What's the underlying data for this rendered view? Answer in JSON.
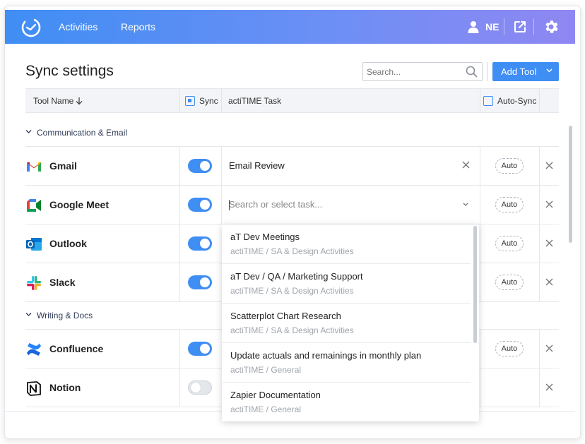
{
  "header": {
    "nav": [
      "Activities",
      "Reports"
    ],
    "user_initials": "NE",
    "icons": [
      "clock-logo-icon",
      "user-icon",
      "external-link-icon",
      "gear-icon"
    ]
  },
  "page": {
    "title": "Sync settings",
    "search_placeholder": "Search...",
    "add_tool_label": "Add Tool"
  },
  "table": {
    "headers": {
      "tool_name": "Tool Name",
      "sync": "Sync",
      "task": "actiTIME Task",
      "auto_sync": "Auto-Sync"
    },
    "groups": [
      {
        "label": "Communication & Email",
        "rows": [
          {
            "name": "Gmail",
            "sync": true,
            "task": "Email Review",
            "auto": "Auto"
          },
          {
            "name": "Google Meet",
            "sync": true,
            "task_placeholder": "Search or select task...",
            "auto": "Auto"
          },
          {
            "name": "Outlook",
            "sync": true,
            "auto": "Auto"
          },
          {
            "name": "Slack",
            "sync": true,
            "auto": "Auto"
          }
        ]
      },
      {
        "label": "Writing & Docs",
        "rows": [
          {
            "name": "Confluence",
            "sync": true,
            "auto": "Auto"
          },
          {
            "name": "Notion",
            "sync": false
          }
        ]
      }
    ]
  },
  "dropdown": {
    "items": [
      {
        "title": "aT Dev Meetings",
        "path": "actiTIME / SA & Design  Activities"
      },
      {
        "title": "aT Dev / QA / Marketing Support",
        "path": "actiTIME / SA & Design  Activities"
      },
      {
        "title": "Scatterplot Chart Research",
        "path": "actiTIME / SA & Design  Activities"
      },
      {
        "title": "Update actuals and remainings in monthly plan",
        "path": "actiTIME / General"
      },
      {
        "title": "Zapier Documentation",
        "path": "actiTIME / General"
      }
    ]
  },
  "colors": {
    "accent": "#3f8ef4",
    "header_gradient_end": "#8f87f2",
    "toggle_off": "#e3e6ea"
  }
}
